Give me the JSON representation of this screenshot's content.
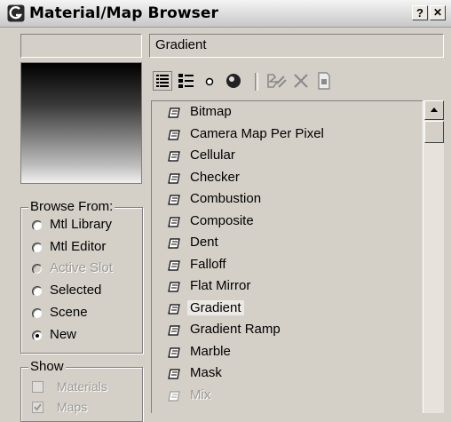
{
  "window": {
    "title": "Material/Map Browser",
    "help_label": "?",
    "close_label": "✕"
  },
  "name_field": {
    "value": "Gradient"
  },
  "browse_from": {
    "label": "Browse From:",
    "options": [
      {
        "label": "Mtl Library",
        "checked": false,
        "enabled": true
      },
      {
        "label": "Mtl Editor",
        "checked": false,
        "enabled": true
      },
      {
        "label": "Active Slot",
        "checked": false,
        "enabled": false
      },
      {
        "label": "Selected",
        "checked": false,
        "enabled": true
      },
      {
        "label": "Scene",
        "checked": false,
        "enabled": true
      },
      {
        "label": "New",
        "checked": true,
        "enabled": true
      }
    ]
  },
  "show": {
    "label": "Show",
    "options": [
      {
        "label": "Materials",
        "checked": false,
        "enabled": false
      },
      {
        "label": "Maps",
        "checked": true,
        "enabled": false
      }
    ]
  },
  "toolbar": {
    "icons": [
      "view-list-icon",
      "view-list-icons-icon",
      "view-small-icons-icon",
      "view-large-icons-icon",
      "update-scene-materials-icon",
      "delete-icon",
      "clear-material-library-icon"
    ]
  },
  "list": {
    "items": [
      {
        "label": "Bitmap",
        "selected": false
      },
      {
        "label": "Camera Map Per Pixel",
        "selected": false
      },
      {
        "label": "Cellular",
        "selected": false
      },
      {
        "label": "Checker",
        "selected": false
      },
      {
        "label": "Combustion",
        "selected": false
      },
      {
        "label": "Composite",
        "selected": false
      },
      {
        "label": "Dent",
        "selected": false
      },
      {
        "label": "Falloff",
        "selected": false
      },
      {
        "label": "Flat Mirror",
        "selected": false
      },
      {
        "label": "Gradient",
        "selected": true
      },
      {
        "label": "Gradient Ramp",
        "selected": false
      },
      {
        "label": "Marble",
        "selected": false
      },
      {
        "label": "Mask",
        "selected": false
      },
      {
        "label": "Mix",
        "selected": false,
        "disabled": true
      }
    ]
  }
}
